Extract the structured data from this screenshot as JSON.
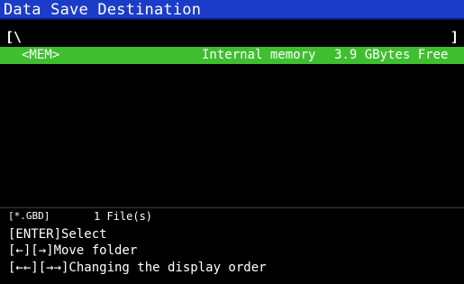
{
  "window": {
    "title": "Data Save Destination"
  },
  "path": {
    "open_bracket": "[\\",
    "close_bracket": "]"
  },
  "list": {
    "items": [
      {
        "name": "<MEM>",
        "description": "Internal memory",
        "size": "3.9 GBytes Free",
        "selected": true
      }
    ]
  },
  "status": {
    "filter": "[*.GBD]",
    "file_count": "1 File(s)"
  },
  "help": {
    "line1": "[ENTER]Select",
    "line2": "[←][→]Move folder",
    "line3": "[←←][→→]Changing the display order"
  },
  "colors": {
    "title_bar": "#1a3cc8",
    "selected_row": "#3fbf2f",
    "background": "#000000",
    "text": "#ffffff"
  }
}
